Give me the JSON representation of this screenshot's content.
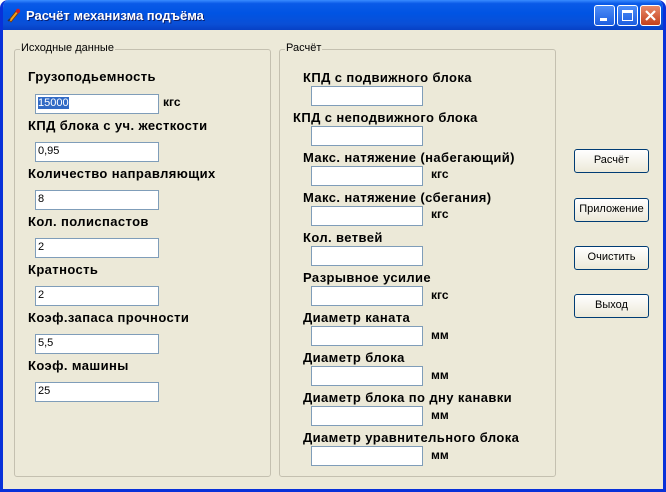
{
  "window": {
    "title": "Расчёт механизма подъёма"
  },
  "input_group": {
    "title": "Исходные данные",
    "fields": [
      {
        "label": "Грузоподьемность",
        "value": "15000",
        "unit": "кгс"
      },
      {
        "label": "КПД блока с уч. жесткости",
        "value": "0,95",
        "unit": ""
      },
      {
        "label": "Количество направляющих",
        "value": "8",
        "unit": ""
      },
      {
        "label": "Кол. полиспастов",
        "value": "2",
        "unit": ""
      },
      {
        "label": "Кратность",
        "value": "2",
        "unit": ""
      },
      {
        "label": "Коэф.запаса прочности",
        "value": "5,5",
        "unit": ""
      },
      {
        "label": "Коэф. машины",
        "value": "25",
        "unit": ""
      }
    ]
  },
  "calc_group": {
    "title": "Расчёт",
    "fields": [
      {
        "label": "КПД с подвижного блока",
        "value": "",
        "unit": ""
      },
      {
        "label": "КПД с неподвижного блока",
        "value": "",
        "unit": ""
      },
      {
        "label": "Макс. натяжение (набегающий)",
        "value": "",
        "unit": "кгс"
      },
      {
        "label": "Макс. натяжение (сбегания)",
        "value": "",
        "unit": "кгс"
      },
      {
        "label": "Кол. ветвей",
        "value": "",
        "unit": ""
      },
      {
        "label": "Разрывное усилие",
        "value": "",
        "unit": "кгс"
      },
      {
        "label": "Диаметр каната",
        "value": "",
        "unit": "мм"
      },
      {
        "label": "Диаметр блока",
        "value": "",
        "unit": "мм"
      },
      {
        "label": "Диаметр блока по дну канавки",
        "value": "",
        "unit": "мм"
      },
      {
        "label": "Диаметр уравнительного блока",
        "value": "",
        "unit": "мм"
      }
    ]
  },
  "buttons": {
    "calculate": "Расчёт",
    "appendix": "Приложение",
    "clear": "Очистить",
    "exit": "Выход"
  }
}
